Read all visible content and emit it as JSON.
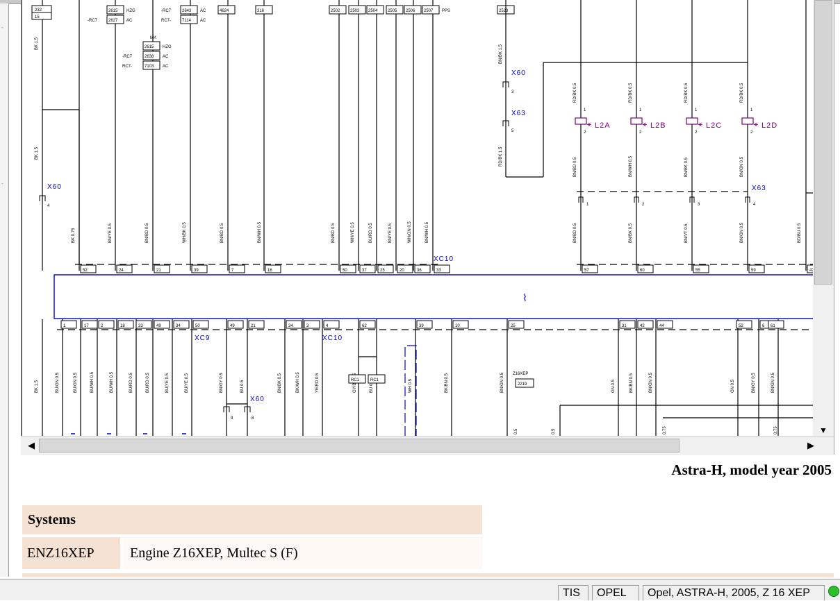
{
  "diagram": {
    "fuse_labels": [
      "232",
      "15"
    ],
    "mk_block": {
      "title": "MK",
      "rows": [
        {
          "left": "",
          "num": "2615",
          "right": "HZG"
        },
        {
          "left": "-RC7",
          "num": "2638",
          "right": "AC"
        },
        {
          "left": "RC7-",
          "num": "7103",
          "right": "AC"
        }
      ]
    },
    "top_blocks": [
      {
        "left": "",
        "num": "2615",
        "right": "HZG"
      },
      {
        "left": "-RC7",
        "num": "2627",
        "right": "AC"
      },
      {
        "left": "-RC7",
        "num": "2643",
        "right": "AC"
      },
      {
        "left": "RC7-",
        "num": "7114",
        "right": "AC"
      },
      {
        "left": "",
        "num": "4624",
        "right": ""
      },
      {
        "left": "",
        "num": "316",
        "right": ""
      },
      {
        "left": "",
        "num": "2502",
        "right": ""
      },
      {
        "left": "",
        "num": "2503",
        "right": ""
      },
      {
        "left": "",
        "num": "2504",
        "right": ""
      },
      {
        "left": "",
        "num": "2505",
        "right": ""
      },
      {
        "left": "",
        "num": "2506",
        "right": ""
      },
      {
        "left": "",
        "num": "2507",
        "right": "PPS"
      },
      {
        "left": "",
        "num": "2523",
        "right": ""
      }
    ],
    "connectors": {
      "x60": "X60",
      "x63": "X63",
      "xc10": "XC10",
      "xc9": "XC9",
      "x60b": "X60"
    },
    "injectors": [
      "L2A",
      "L2B",
      "L2C",
      "L2D"
    ],
    "top_wires": [
      "BK 1.5",
      "BK 1.5",
      "BK 0.75",
      "BN/YE 0.5",
      "BN/BD 0.5",
      "WH/BK 0.5",
      "BN/BD 0.5",
      "BN/WH 0.5",
      "BN/BD 0.5",
      "WH/YE 0.5",
      "BU/RD 0.5",
      "BN/YE 0.5",
      "WH/GN 0.5",
      "BN/WH 0.5",
      "BN/BK 1.5",
      "RD/BK 1.5",
      "RD/BK 0.5",
      "RD/BK 0.5",
      "RD/BK 0.5",
      "RD/BK 0.5",
      "BN/BD 0.5",
      "BN/WH 0.5",
      "BN/BK 0.5",
      "BN/GN 0.5",
      "BN/BD 0.5",
      "BN/BK 0.5",
      "BN/VT 0.5",
      "BN/GN 0.5",
      "BD/BU 0.5"
    ],
    "top_pins": [
      "52",
      "24",
      "21",
      "39",
      "7",
      "16",
      "50",
      "37",
      "25",
      "20",
      "36",
      "33",
      "57",
      "60",
      "55",
      "59",
      "47"
    ],
    "x63_pins": [
      "1",
      "2",
      "3",
      "4"
    ],
    "bottom_pins": [
      "1",
      "17",
      "2",
      "18",
      "33",
      "49",
      "34",
      "50",
      "49",
      "21",
      "34",
      "3",
      "4",
      "62",
      "39",
      "10",
      "25",
      "31",
      "42",
      "44",
      "52",
      "6",
      "61"
    ],
    "bottom_wires": [
      "BK 1.5",
      "BU/GN 0.5",
      "BU/GN 0.5",
      "BU/WH 0.5",
      "BU/WH 0.5",
      "BU/RD 0.5",
      "BU/RD 0.5",
      "BU/YE 0.5",
      "BU/YE 0.5",
      "BN/GY 0.5",
      "BU 0.5",
      "BN/BK 0.5",
      "BK/WH 0.5",
      "YE/RD 0.5",
      "GY/BK 0.5",
      "BU 0.5",
      "WH 0.5",
      "BK/BN 0.5",
      "BN/GN 0.5",
      "GN 0.5",
      "BK/BN 0.5",
      "BN/GN 0.5",
      "GN 0.5",
      "BN/GY 0.5",
      "BN/GN 0.5"
    ],
    "rc_labels": [
      "RC1",
      "RC1"
    ],
    "z16xep": {
      "title": "Z16XEP",
      "num": "2219"
    },
    "bottom_sizes": [
      "0.5",
      "0.5",
      "0.75",
      "0.75"
    ],
    "x60_bottom_pins": [
      "9",
      "8"
    ],
    "x60_top_pin_a": "3",
    "x63_top_pin": "5",
    "x60_left_pin": "4"
  },
  "document": {
    "title": "Astra-H, model year 2005",
    "systems_header": "Systems",
    "systems": [
      {
        "code": "ENZ16XEP",
        "description": "Engine Z16XEP, Multec S (F)"
      }
    ]
  },
  "statusbar": {
    "tis": "TIS",
    "brand": "OPEL",
    "vehicle": "Opel, ASTRA-H, 2005, Z 16 XEP"
  },
  "colors": {
    "wire": "#000000",
    "connector": "#0000cc",
    "injector": "#800080",
    "table_header_bg": "#f6e2d2",
    "status_ok": "#2dc02d"
  }
}
